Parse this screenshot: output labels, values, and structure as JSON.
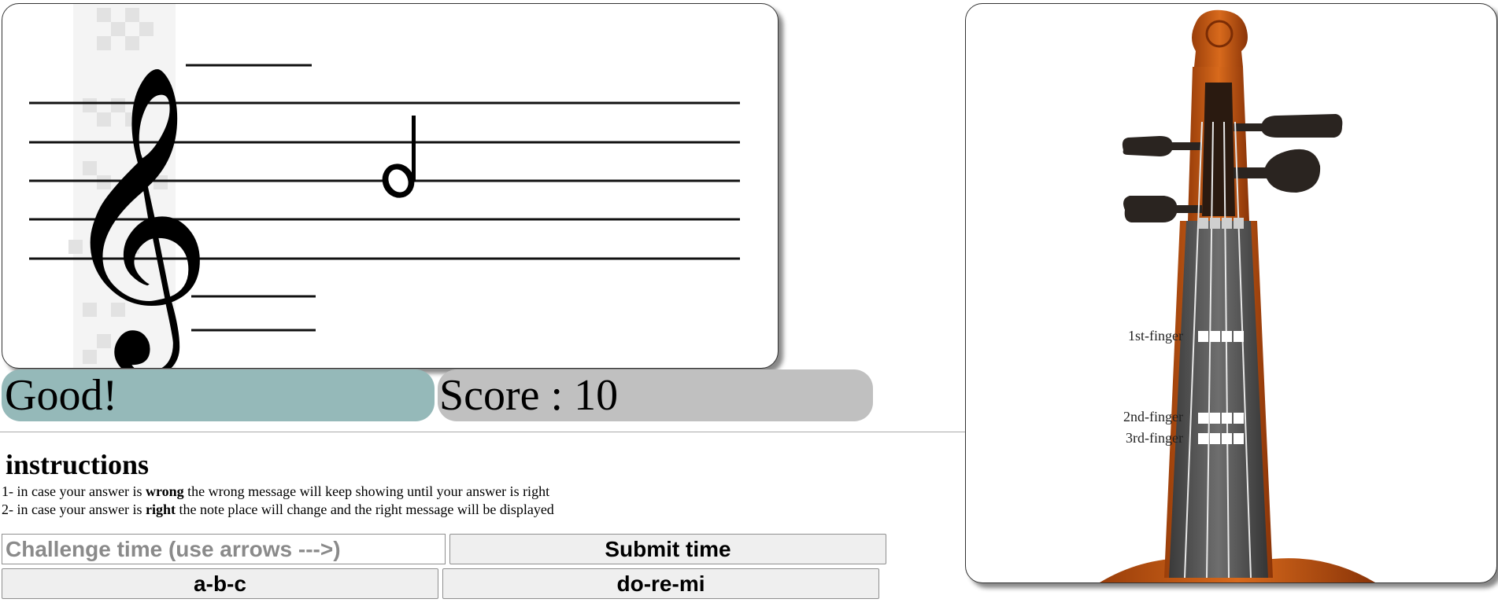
{
  "staff": {
    "clef": "treble-clef",
    "note": {
      "type": "half-note"
    }
  },
  "status": {
    "message": "Good!",
    "score": "Score : 10",
    "message_color": "#95b9b9",
    "score_color": "#c0c0c0"
  },
  "instructions": {
    "title": "instructions",
    "line1": {
      "prefix": "1- in case your answer is ",
      "keyword": "wrong",
      "suffix": " the wrong message will keep showing until your answer is right"
    },
    "line2": {
      "prefix": "2- in case your answer is ",
      "keyword": "right",
      "suffix": " the note place will change and the right message will be displayed"
    }
  },
  "controls": {
    "challenge_placeholder": "Challenge time (use arrows --->)",
    "challenge_value": "",
    "submit_label": "Submit time",
    "abc_label": "a-b-c",
    "doremi_label": "do-re-mi"
  },
  "violin": {
    "fingers": [
      {
        "label": "1st-finger"
      },
      {
        "label": "2nd-finger"
      },
      {
        "label": "3rd-finger"
      }
    ]
  }
}
